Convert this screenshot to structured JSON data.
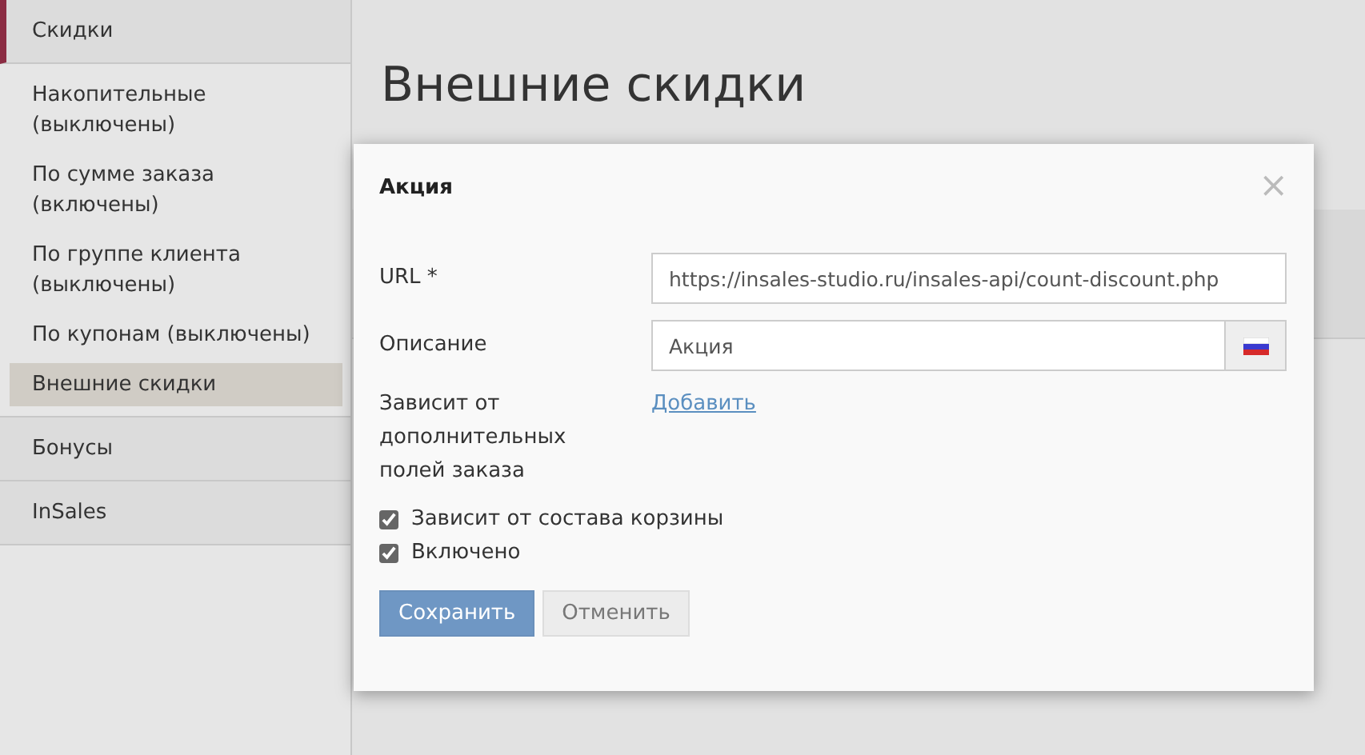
{
  "sidebar": {
    "sections": [
      {
        "label": "Скидки",
        "selected": true,
        "children": [
          {
            "label": "Накопительные (выключены)",
            "selected": false
          },
          {
            "label": "По сумме заказа (включены)",
            "selected": false
          },
          {
            "label": "По группе клиента (выключены)",
            "selected": false
          },
          {
            "label": "По купонам (выключены)",
            "selected": false
          },
          {
            "label": "Внешние скидки",
            "selected": true
          }
        ]
      },
      {
        "label": "Бонусы",
        "selected": false
      },
      {
        "label": "InSales",
        "selected": false
      }
    ]
  },
  "page": {
    "title": "Внешние скидки"
  },
  "dialog": {
    "title": "Акция",
    "close": "×",
    "fields": [
      {
        "kind": "input",
        "label": "URL *",
        "value": "https://insales-studio.ru/insales-api/count-discount.php"
      },
      {
        "kind": "localized",
        "label": "Описание",
        "value": "Акция"
      },
      {
        "kind": "link",
        "label": "Зависит от дополнительных полей заказа",
        "link": "Добавить"
      }
    ],
    "checkboxes": [
      {
        "label": "Зависит от состава корзины",
        "checked": true
      },
      {
        "label": "Включено",
        "checked": true
      }
    ],
    "buttons": [
      {
        "label": "Сохранить",
        "kind": "primary"
      },
      {
        "label": "Отменить",
        "kind": "secondary"
      }
    ]
  }
}
